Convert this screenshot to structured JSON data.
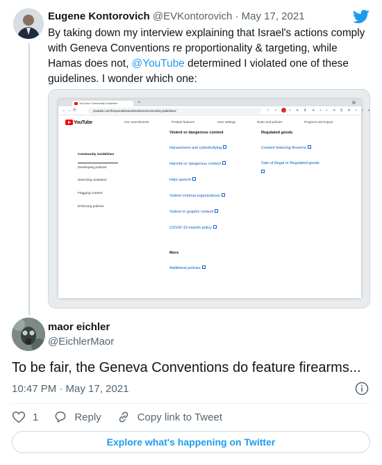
{
  "parent_tweet": {
    "author_name": "Eugene Kontorovich",
    "author_handle": "@EVKontorovich",
    "date_separator": " · ",
    "date": "May 17, 2021",
    "text_part1": "By taking down my interview explaining that Israel's actions comply with Geneva Conventions re proportionality & targeting, while Hamas does not, ",
    "mention": "@YouTube",
    "text_part2": " determined I violated one of these guidelines. I wonder which one:",
    "avatar_icon": "person-avatar",
    "brand_icon": "twitter-bird-icon",
    "brand_color": "#1d9bf0"
  },
  "embedded_screenshot": {
    "tab_title": "YouTube Community Guideline",
    "url": "youtube.com/howyoutubeworks/policies/community-guidelines/",
    "site_logo_text": "YouTube",
    "nav": [
      "Our commitments",
      "Product features",
      "User settings",
      "Rules and policies",
      "Progress and impact"
    ],
    "sidebar": [
      "Community Guidelines",
      "Developing policies",
      "Detecting violations",
      "Flagging content",
      "Enforcing policies"
    ],
    "col1_heading": "Violent or dangerous content",
    "col1_links": [
      "Harassment and cyberbullying",
      "Harmful or dangerous content",
      "Hate speech",
      "Violent criminal organizations",
      "Violent or graphic content",
      "COVID-19 misinfo policy"
    ],
    "more_heading": "More",
    "more_links": [
      "Additional policies"
    ],
    "col2_heading": "Regulated goods",
    "col2_links": [
      "Content featuring firearms",
      "Sale of illegal or Regulated goods"
    ]
  },
  "reply_tweet": {
    "author_name": "maor eichler",
    "author_handle": "@EichlerMaor",
    "text": "To be fair, the Geneva Conventions do feature firearms...",
    "timestamp": "10:47 PM · May 17, 2021",
    "avatar_icon": "gas-mask-avatar",
    "info_icon": "info-icon"
  },
  "actions": {
    "like_count": "1",
    "reply_label": "Reply",
    "copy_link_label": "Copy link to Tweet"
  },
  "explore_button": "Explore what's happening on Twitter"
}
